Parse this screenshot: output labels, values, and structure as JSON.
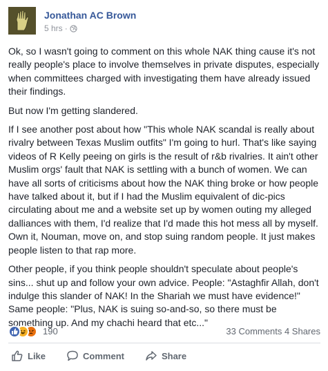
{
  "post": {
    "author": "Jonathan AC Brown",
    "time": "5 hrs",
    "separator": "·",
    "privacy_icon": "globe-icon",
    "paragraphs": [
      "Ok, so I wasn't going to comment on this whole NAK thing cause it's not really people's place to involve themselves in private disputes, especially when committees charged with investigating them have already issued their findings.",
      "But now I'm getting slandered.",
      "If I see another post about how \"This whole NAK scandal is really about rivalry between Texas Muslim outfits\" I'm going to hurl. That's like saying videos of R Kelly peeing on girls is the result of r&b rivalries. It ain't other Muslim orgs' fault that NAK is settling with a bunch of women. We can have all sorts of criticisms about how the NAK thing broke or how people have talked about it, but if I had the Muslim equivalent of dic-pics circulating about me and a website set up by women outing my alleged dalliances with them, I'd realize that I'd made this hot mess all by myself. Own it, Nouman, move on, and stop suing random people. It just makes people listen to that rap more.",
      "Other people, if you think people shouldn't speculate about people's sins... shut up and follow your own advice. People: \"Astaghfir Allah, don't indulge this slander of NAK! In the Shariah we must have evidence!\" Same people: \"Plus, NAK is suing so-and-so, so there must be something up. And my chachi heard that etc...\""
    ]
  },
  "reactions": {
    "count": "190",
    "icons": [
      "like-icon",
      "haha-icon",
      "angry-icon"
    ],
    "comments": "33 Comments",
    "shares": "4 Shares"
  },
  "actions": {
    "like": "Like",
    "comment": "Comment",
    "share": "Share"
  },
  "colors": {
    "author_link": "#365899",
    "meta_gray": "#90949c",
    "like_blue": "#4267b2",
    "haha_yellow": "#f7b125",
    "angry_orange": "#e9710f",
    "action_gray": "#606770"
  }
}
